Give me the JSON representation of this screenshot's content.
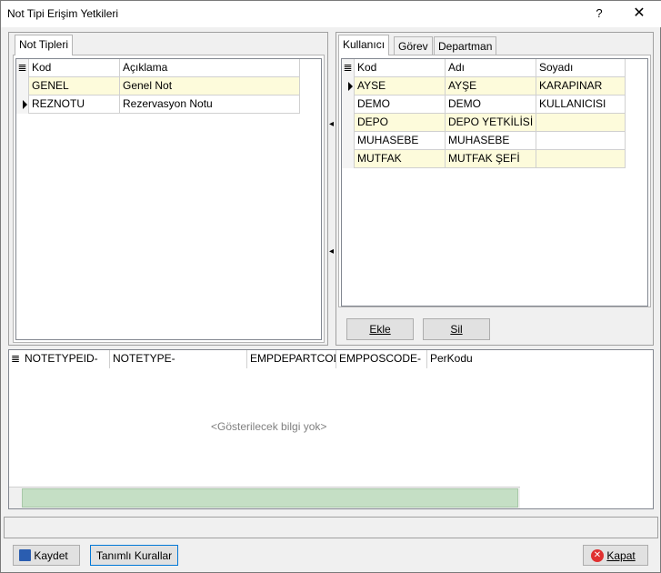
{
  "window": {
    "title": "Not Tipi Erişim Yetkileri",
    "help_glyph": "?",
    "close_glyph": "✕"
  },
  "left_panel": {
    "tab_label": "Not Tipleri",
    "columns": [
      "Kod",
      "Açıklama"
    ],
    "rows": [
      {
        "kod": "GENEL",
        "aciklama": "Genel Not"
      },
      {
        "kod": "REZNOTU",
        "aciklama": "Rezervasyon Notu"
      }
    ]
  },
  "right_panel": {
    "tabs": [
      "Kullanıcı",
      "Görev",
      "Departman"
    ],
    "columns": [
      "Kod",
      "Adı",
      "Soyadı"
    ],
    "rows": [
      {
        "kod": "AYSE",
        "adi": "AYŞE",
        "soyadi": "KARAPINAR"
      },
      {
        "kod": "DEMO",
        "adi": "DEMO",
        "soyadi": "KULLANICISI"
      },
      {
        "kod": "DEPO",
        "adi": "DEPO YETKİLİSİ",
        "soyadi": ""
      },
      {
        "kod": "MUHASEBE",
        "adi": "MUHASEBE",
        "soyadi": ""
      },
      {
        "kod": "MUTFAK",
        "adi": "MUTFAK ŞEFİ",
        "soyadi": ""
      }
    ],
    "add_button": "Ekle",
    "delete_button": "Sil"
  },
  "bottom_grid": {
    "columns": [
      "NOTETYPEID-",
      "NOTETYPE-",
      "EMPDEPARTCODE",
      "EMPPOSCODE-",
      "PerKodu"
    ],
    "empty_message": "<Gösterilecek bilgi yok>"
  },
  "footer": {
    "save_button": "Kaydet",
    "rules_button": "Tanımlı Kurallar",
    "close_button": "Kapat"
  },
  "colors": {
    "alt_row": "#fdfbdb",
    "scroll_thumb": "#c5dfc5",
    "close_icon": "#e03030",
    "save_icon": "#2a5db0"
  }
}
